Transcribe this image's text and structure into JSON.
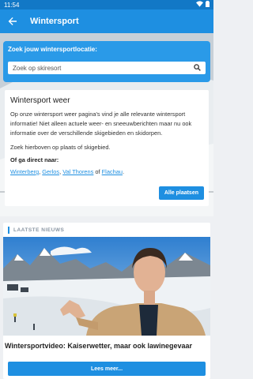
{
  "statusbar": {
    "time": "11:54"
  },
  "appbar": {
    "title": "Wintersport"
  },
  "search": {
    "label": "Zoek jouw wintersportlocatie:",
    "placeholder": "Zoek op skiresort"
  },
  "info": {
    "title": "Wintersport weer",
    "paragraph": "Op onze wintersport weer pagina's vind je alle relevante wintersport informatie! Niet alleen actuele weer- en sneeuwberichten maar nu ook informatie over de verschillende skigebieden en skidorpen.",
    "search_hint": "Zoek hierboven op plaats of skigebied.",
    "direct_label": "Of ga direct naar:",
    "links": [
      "Winterberg",
      "Gerlos",
      "Val Thorens",
      "Flachau"
    ],
    "separator": ",",
    "conjunction": "of",
    "end": ".",
    "all_button": "Alle plaatsen"
  },
  "news": {
    "section_label": "LAATSTE NIEUWS",
    "headline": "Wintersportvideo: Kaiserwetter, maar ook lawinegevaar",
    "more_button": "Lees meer..."
  },
  "colors": {
    "primary": "#1e8fe1",
    "statusbar": "#1278c6",
    "search_card": "#2a9ae8"
  },
  "icons": [
    "wifi-icon",
    "battery-icon",
    "back-arrow-icon",
    "search-icon"
  ]
}
